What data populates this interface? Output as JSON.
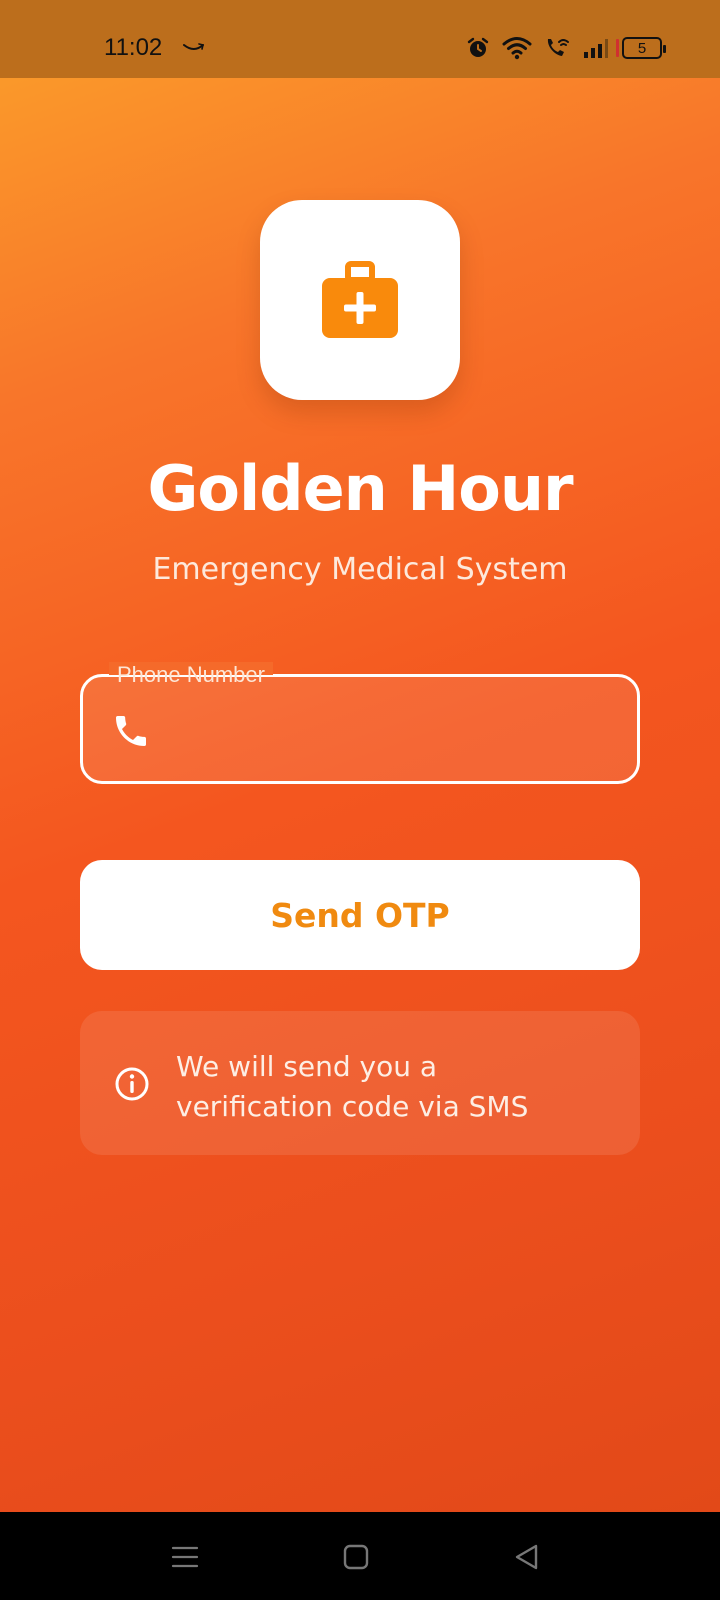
{
  "status_bar": {
    "time": "11:02",
    "battery_level": "5",
    "icons": [
      "amazon-smile-icon",
      "alarm-icon",
      "wifi-icon",
      "wifi-call-icon",
      "signal-icon",
      "battery-icon"
    ]
  },
  "app": {
    "logo_icon": "medical-kit-icon",
    "title": "Golden Hour",
    "subtitle": "Emergency Medical System"
  },
  "phone_field": {
    "label": "Phone Number",
    "value": "",
    "icon": "phone-icon"
  },
  "send_button": {
    "label": "Send OTP"
  },
  "info": {
    "icon": "info-icon",
    "text": "We will send you a verification code via SMS"
  },
  "nav_bar": {
    "buttons": [
      "menu-icon",
      "home-icon",
      "back-icon"
    ]
  },
  "colors": {
    "accent": "#f08a10",
    "gradient_top": "#fba12a",
    "gradient_bottom": "#e04817",
    "status_bar": "#bc6e1c"
  }
}
